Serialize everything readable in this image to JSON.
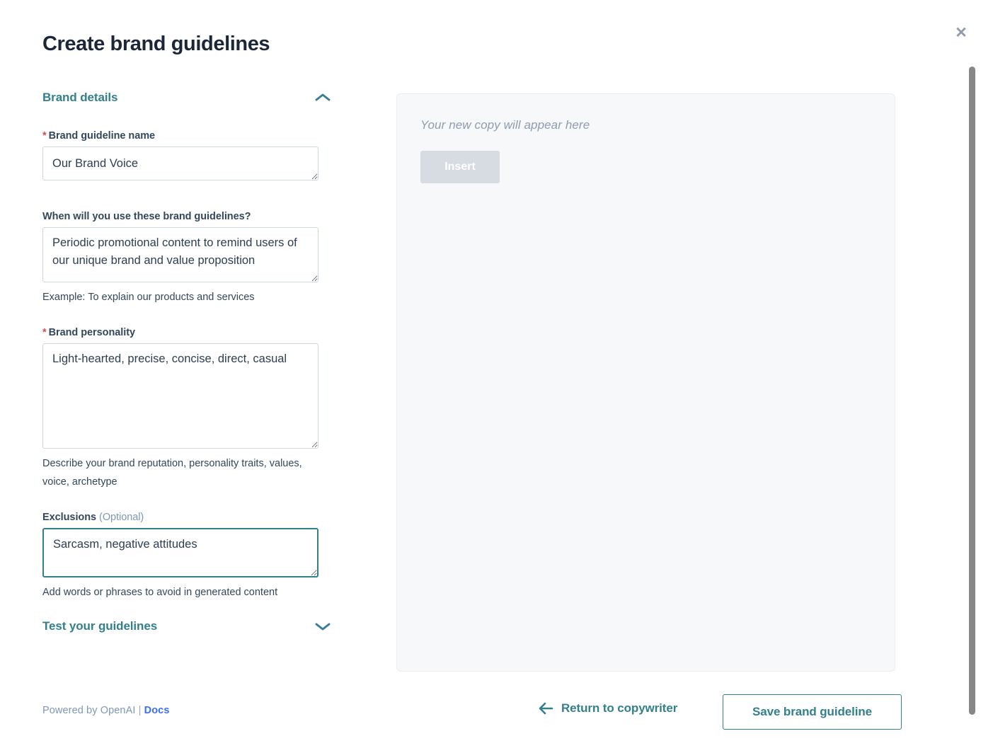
{
  "header": {
    "title": "Create brand guidelines",
    "close_icon": "close-icon"
  },
  "sections": {
    "brand_details": {
      "label": "Brand details",
      "expanded": true,
      "chevron_icon": "chevron-up-icon"
    },
    "test_guidelines": {
      "label": "Test your guidelines",
      "expanded": false,
      "chevron_icon": "chevron-down-icon"
    }
  },
  "fields": {
    "guideline_name": {
      "label": "Brand guideline name",
      "required": true,
      "required_marker": "*",
      "value": "Our Brand Voice",
      "placeholder": ""
    },
    "when_use": {
      "label": "When will you use these brand guidelines?",
      "required": false,
      "value": "Periodic promotional content to remind users of our unique brand and value proposition",
      "placeholder": "",
      "hint": "Example: To explain our products and services"
    },
    "brand_personality": {
      "label": "Brand personality",
      "required": true,
      "required_marker": "*",
      "value": "Light-hearted, precise, concise, direct, casual",
      "placeholder": "",
      "hint": "Describe your brand reputation, personality traits, values, voice, archetype"
    },
    "exclusions": {
      "label": "Exclusions",
      "optional_suffix": "(Optional)",
      "value": "Sarcasm, negative attitudes",
      "placeholder": "",
      "hint": "Add words or phrases to avoid in generated content",
      "focused": true
    }
  },
  "footer_left": {
    "powered_by": "Powered by OpenAI",
    "separator": "|",
    "docs_link": "Docs"
  },
  "preview": {
    "placeholder": "Your new copy will appear here",
    "insert_label": "Insert",
    "insert_disabled": true
  },
  "actions": {
    "return_label": "Return to copywriter",
    "return_icon": "arrow-left-icon",
    "save_label": "Save brand guideline"
  },
  "colors": {
    "accent_teal": "#33808d",
    "title_navy": "#1b2738",
    "label_slate": "#33475b",
    "required_red": "#d94c53",
    "link_blue": "#3b6ff0",
    "muted_gray": "#7c98b6",
    "panel_bg": "#f6f8f9",
    "border_gray": "#cbd6e2",
    "disabled_btn": "#d6dce2"
  },
  "scrollbar": {
    "orientation": "vertical",
    "position": "right"
  }
}
